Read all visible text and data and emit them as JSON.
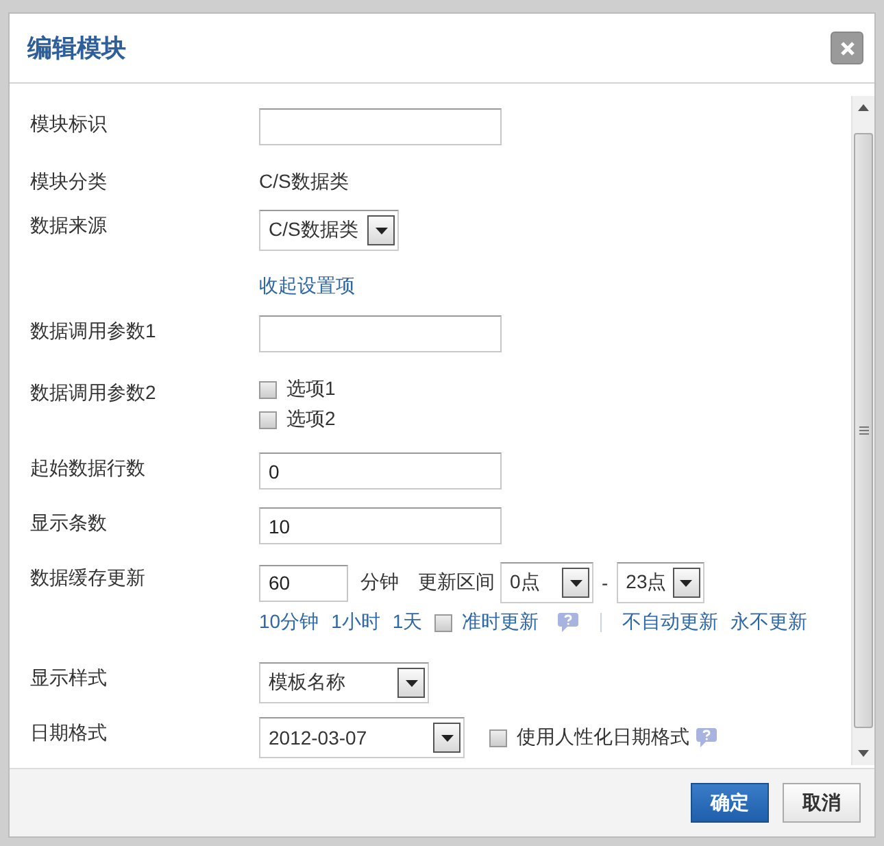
{
  "dialog": {
    "title": "编辑模块"
  },
  "fields": [
    {
      "kind": "text",
      "label": "模块标识"
    },
    {
      "kind": "static",
      "label": "模块分类",
      "value": "C/S数据类"
    },
    {
      "kind": "select",
      "label": "数据来源",
      "value": "C/S数据类"
    },
    {
      "kind": "link",
      "link": "收起设置项"
    },
    {
      "kind": "text",
      "label": "数据调用参数1"
    },
    {
      "kind": "checks",
      "label": "数据调用参数2",
      "options": [
        {
          "label": "选项1",
          "checked": false
        },
        {
          "label": "选项2",
          "checked": false
        }
      ]
    },
    {
      "kind": "text",
      "label": "起始数据行数",
      "value": "0"
    },
    {
      "kind": "text",
      "label": "显示条数",
      "value": "10"
    },
    {
      "kind": "cache",
      "label": "数据缓存更新",
      "value": "60",
      "unit": "分钟",
      "range_label": "更新区间",
      "from": "0点",
      "separator": "-",
      "to": "23点",
      "presets": [
        "10分钟",
        "1小时",
        "1天"
      ],
      "on_time": {
        "label": "准时更新",
        "checked": false
      },
      "links": [
        "不自动更新",
        "永不更新"
      ]
    },
    {
      "kind": "select",
      "label": "显示样式",
      "value": "模板名称"
    },
    {
      "kind": "date",
      "label": "日期格式",
      "value": "2012-03-07",
      "option": {
        "label": "使用人性化日期格式",
        "checked": false
      }
    }
  ],
  "buttons": [
    {
      "label": "确定",
      "kind": "primary"
    },
    {
      "label": "取消",
      "kind": "default"
    }
  ]
}
